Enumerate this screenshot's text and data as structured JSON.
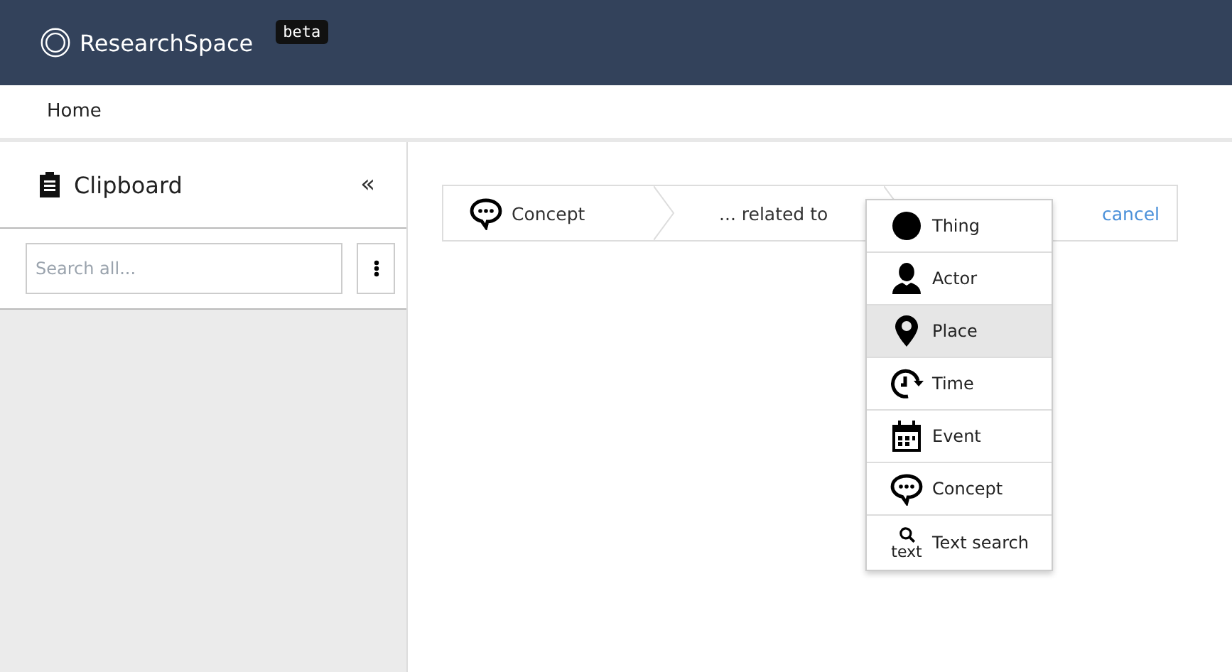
{
  "header": {
    "brand": "ResearchSpace",
    "badge": "beta"
  },
  "nav": {
    "items": [
      "Home"
    ]
  },
  "clipboard": {
    "title": "Clipboard",
    "collapse": "«",
    "search": {
      "placeholder": "Search all..."
    }
  },
  "breadcrumb": {
    "steps": [
      {
        "label": "Concept",
        "kind": "concept"
      },
      {
        "label": "... related to",
        "kind": "plain"
      }
    ],
    "cancel": "cancel"
  },
  "menu": {
    "items": [
      {
        "label": "Thing",
        "kind": "thing",
        "selected": false
      },
      {
        "label": "Actor",
        "kind": "actor",
        "selected": false
      },
      {
        "label": "Place",
        "kind": "place",
        "selected": true
      },
      {
        "label": "Time",
        "kind": "time",
        "selected": false
      },
      {
        "label": "Event",
        "kind": "event",
        "selected": false
      },
      {
        "label": "Concept",
        "kind": "concept",
        "selected": false
      },
      {
        "label": "Text search",
        "kind": "text",
        "icon_text": "text",
        "selected": false
      }
    ]
  }
}
